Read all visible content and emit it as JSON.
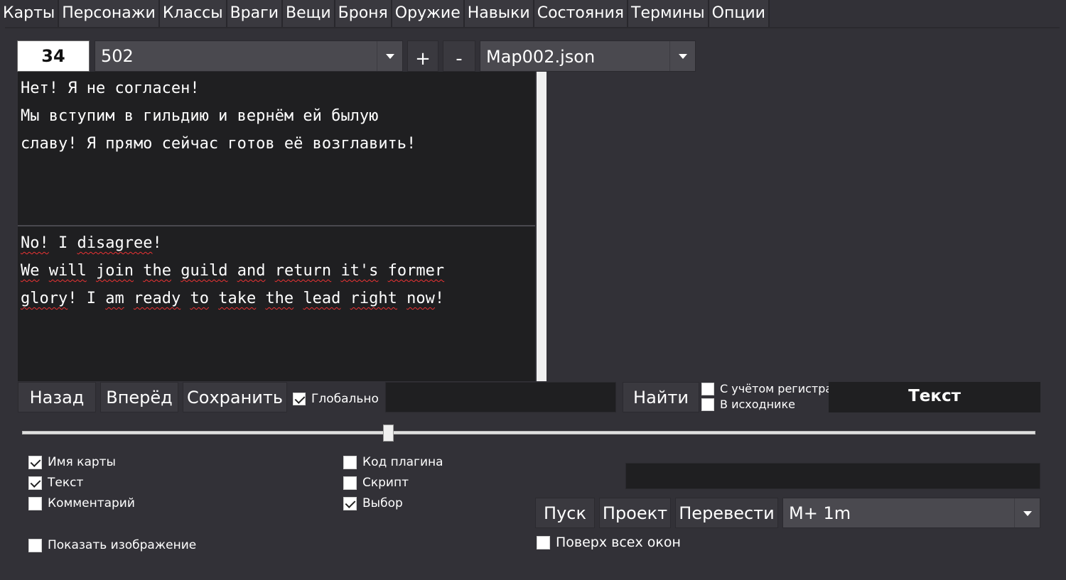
{
  "tabs": [
    "Карты",
    "Персонажи",
    "Классы",
    "Враги",
    "Вещи",
    "Броня",
    "Оружие",
    "Навыки",
    "Состояния",
    "Термины",
    "Опции"
  ],
  "top": {
    "index_value": "34",
    "entry_select": "502",
    "plus_label": "+",
    "minus_label": "-",
    "file_select": "Map002.json"
  },
  "source_text": {
    "lines": [
      "Нет! Я не согласен!",
      "Мы вступим в гильдию и вернём ей былую",
      "славу! Я прямо сейчас готов её возглавить!"
    ]
  },
  "translation_text": {
    "line1": {
      "w1": "No!",
      "s1": " I ",
      "w2": "disagree",
      "s2": "!"
    },
    "line2": {
      "w1": "We",
      "s1": " ",
      "w2": "will",
      "s2": " ",
      "w3": "join",
      "s3": " ",
      "w4": "the",
      "s4": " ",
      "w5": "guild",
      "s5": " ",
      "w6": "and",
      "s6": " ",
      "w7": "return",
      "s7": " ",
      "w8": "it's",
      "s8": " ",
      "w9": "former"
    },
    "line3": {
      "w1": "glory",
      "s1": "! I ",
      "w2": "am",
      "s2": " ",
      "w3": "ready",
      "s3": " ",
      "w4": "to",
      "s4": " ",
      "w5": "take",
      "s5": " ",
      "w6": "the",
      "s6": " ",
      "w7": "lead",
      "s7": " ",
      "w8": "right",
      "s8": " ",
      "w9": "now",
      "s9": "!"
    }
  },
  "nav": {
    "back_label": "Назад",
    "forward_label": "Вперёд",
    "save_label": "Сохранить",
    "global_label": "Глобально",
    "global_checked": true,
    "find_label": "Найти",
    "case_label": "С учётом регистра",
    "source_label": "В исходнике",
    "mode_label": "Текст"
  },
  "slider": {
    "value_fraction": 0.36
  },
  "filters": {
    "map_name": {
      "label": "Имя карты",
      "checked": true
    },
    "text": {
      "label": "Текст",
      "checked": true
    },
    "comment": {
      "label": "Комментарий",
      "checked": false
    },
    "show_image": {
      "label": "Показать изображение",
      "checked": false
    },
    "plugin_code": {
      "label": "Код плагина",
      "checked": false
    },
    "script": {
      "label": "Скрипт",
      "checked": false
    },
    "choice": {
      "label": "Выбор",
      "checked": true
    }
  },
  "actions": {
    "run_label": "Пуск",
    "project_label": "Проект",
    "translate_label": "Перевести",
    "engine_select": "M+ 1m",
    "on_top_label": "Поверх всех окон",
    "on_top_checked": false
  },
  "colors": {
    "background": "#323137",
    "field": "#1f1f21",
    "button": "#3a393f",
    "combo": "#4a494f",
    "spell_underline": "#e33333"
  }
}
